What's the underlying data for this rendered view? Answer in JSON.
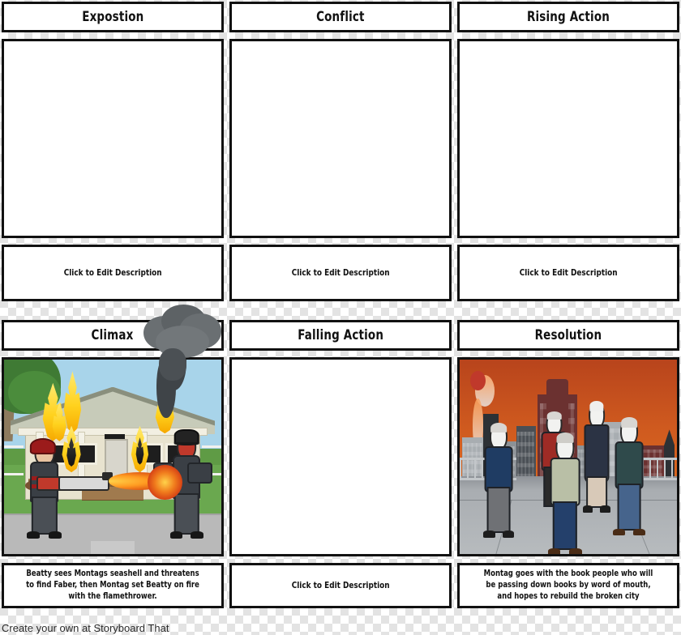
{
  "storyboard": {
    "title_bar_note": "Fahrenheit 451 plot diagram storyboard",
    "footer": "Create your own at Storyboard That",
    "default_description": "Click to Edit Description",
    "colors": {
      "border": "#111111",
      "panel_background": "#ffffff",
      "canvas_checker_light": "#ffffff",
      "canvas_checker_dark": "#e3e3e3",
      "climax_sky": "#a8d4ea",
      "climax_grass": "#6aa84f",
      "climax_house": "#e8e3cf",
      "flame_yellow": "#ffd21e",
      "smoke_gray": "#3f4448",
      "resolution_sky": "#cf5a1f",
      "resolution_plaza": "#b7bbbe"
    },
    "cells": [
      {
        "id": "exposition",
        "title": "Expostion",
        "description": "Click to Edit Description",
        "has_image": false,
        "image_alt": ""
      },
      {
        "id": "conflict",
        "title": "Conflict",
        "description": "Click to Edit Description",
        "has_image": false,
        "image_alt": ""
      },
      {
        "id": "rising-action",
        "title": "Rising Action",
        "description": "Click to Edit Description",
        "has_image": false,
        "image_alt": ""
      },
      {
        "id": "climax",
        "title": "Climax",
        "description": "Beatty sees Montags seashell and threatens to find Faber, then Montag set Beatty on fire with the flamethrower.",
        "has_image": true,
        "image_alt": "Firefighter with flamethrower setting a burning house and Beatty on fire"
      },
      {
        "id": "falling-action",
        "title": "Falling Action",
        "description": "Click to Edit Description",
        "has_image": false,
        "image_alt": ""
      },
      {
        "id": "resolution",
        "title": "Resolution",
        "description": "Montag goes with the book people who will be passing down books by word of mouth, and hopes to rebuild the broken city",
        "has_image": true,
        "image_alt": "Five people standing on a plaza before a burning orange city skyline"
      }
    ]
  }
}
